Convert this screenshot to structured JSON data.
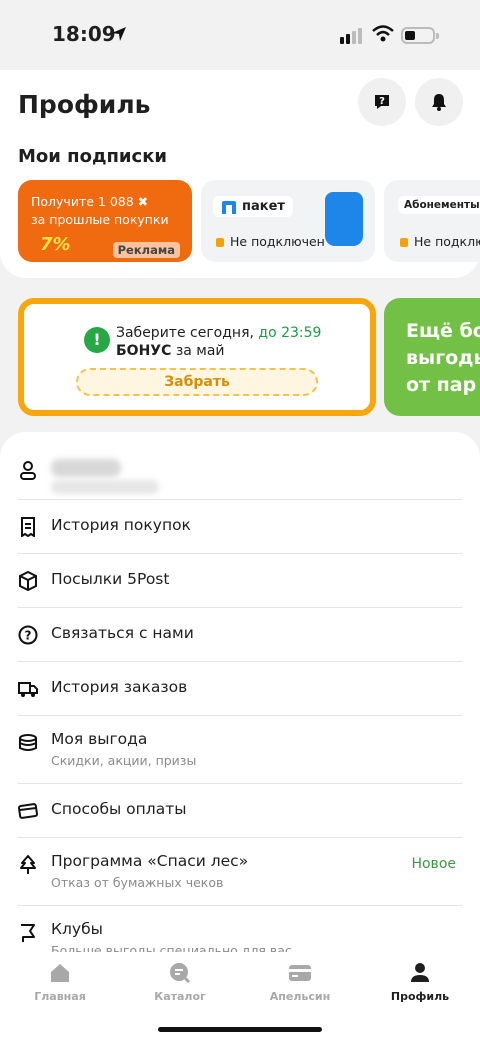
{
  "status_bar": {
    "time": "18:09"
  },
  "header": {
    "title": "Профиль"
  },
  "subscriptions": {
    "title": "Мои подписки",
    "promo": {
      "line1": "Получите 1 088",
      "line2": "за прошлые покупки",
      "badge_text": "7%",
      "ad_label": "Реклама"
    },
    "paket": {
      "logo": "пакет",
      "status": "Не подключен"
    },
    "clubs": {
      "logo": "Абонементы",
      "status": "Не подключен"
    }
  },
  "bonus": {
    "line1": "Заберите сегодня,",
    "deadline": "до 23:59",
    "line2_bold": "БОНУС",
    "line2_rest": "за май",
    "button": "Забрать"
  },
  "green_promo": {
    "line1": "Ещё бо",
    "line2": "выгоды",
    "line3": "от пар"
  },
  "menu": {
    "purchase_history": "История покупок",
    "parcels": "Посылки 5Post",
    "contact": "Связаться с нами",
    "order_history": "История заказов",
    "my_benefit": "Моя выгода",
    "my_benefit_sub": "Скидки, акции, призы",
    "payment_methods": "Способы оплаты",
    "save_forest": "Программа «Спаси лес»",
    "save_forest_sub": "Отказ от бумажных чеков",
    "save_forest_badge": "Новое",
    "clubs": "Клубы",
    "clubs_sub": "Больше выгоды специально для вас"
  },
  "tabs": {
    "home": "Главная",
    "catalog": "Каталог",
    "apelsin": "Апельсин",
    "profile": "Профиль"
  },
  "colors": {
    "accent_orange": "#f06a10",
    "bonus_border": "#f7a70c",
    "green": "#72c046",
    "success": "#1f9a48"
  }
}
